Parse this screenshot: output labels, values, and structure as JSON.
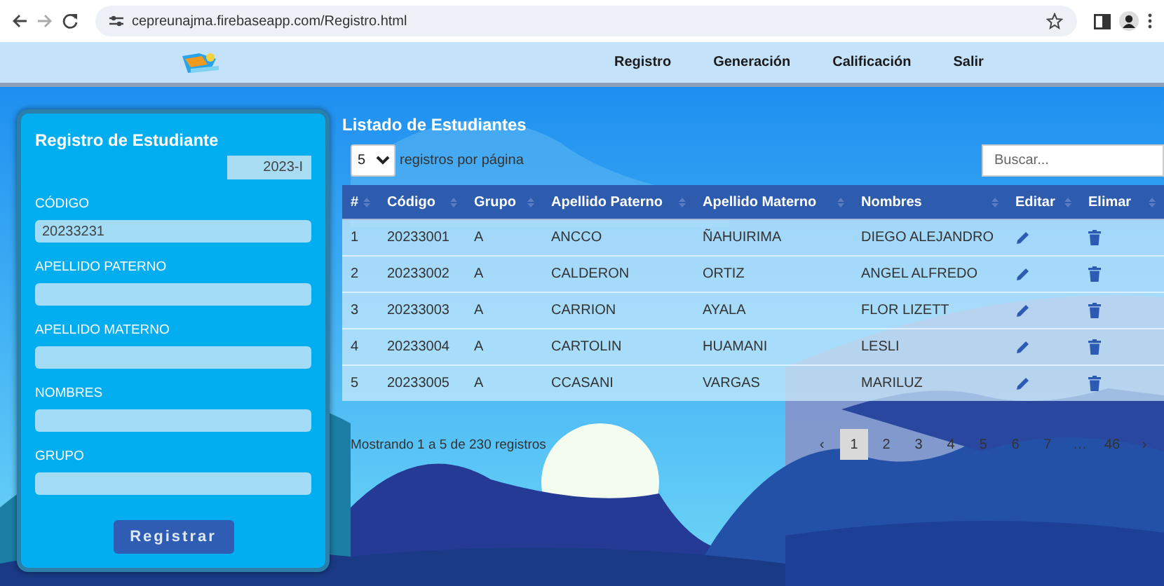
{
  "browser": {
    "url": "cepreunajma.firebaseapp.com/Registro.html"
  },
  "nav": {
    "items": [
      {
        "label": "Registro"
      },
      {
        "label": "Generación"
      },
      {
        "label": "Calificación"
      },
      {
        "label": "Salir"
      }
    ]
  },
  "form": {
    "title": "Registro de Estudiante",
    "period": "2023-I",
    "submit": "Registrar",
    "fields": [
      {
        "label": "CÓDIGO",
        "value": "20233231"
      },
      {
        "label": "APELLIDO PATERNO"
      },
      {
        "label": "APELLIDO MATERNO"
      },
      {
        "label": "NOMBRES"
      },
      {
        "label": "GRUPO"
      }
    ]
  },
  "list": {
    "title": "Listado de Estudiantes",
    "page_size": "5",
    "page_size_label": "registros por página",
    "search": {
      "placeholder": "Buscar..."
    },
    "columns": [
      "#",
      "Código",
      "Grupo",
      "Apellido Paterno",
      "Apellido Materno",
      "Nombres",
      "Editar",
      "Elimar"
    ],
    "rows": [
      [
        "1",
        "20233001",
        "A",
        "ANCCO",
        "ÑAHUIRIMA",
        "DIEGO ALEJANDRO"
      ],
      [
        "2",
        "20233002",
        "A",
        "CALDERON",
        "ORTIZ",
        "ANGEL ALFREDO"
      ],
      [
        "3",
        "20233003",
        "A",
        "CARRION",
        "AYALA",
        "FLOR LIZETT"
      ],
      [
        "4",
        "20233004",
        "A",
        "CARTOLIN",
        "HUAMANI",
        "LESLI"
      ],
      [
        "5",
        "20233005",
        "A",
        "CCASANI",
        "VARGAS",
        "MARILUZ"
      ]
    ],
    "summary": "Mostrando 1 a 5 de 230 registros",
    "pages": [
      {
        "label": "‹",
        "selected": false
      },
      {
        "label": "1",
        "selected": true
      },
      {
        "label": "2",
        "selected": false
      },
      {
        "label": "3",
        "selected": false
      },
      {
        "label": "4",
        "selected": false
      },
      {
        "label": "5",
        "selected": false
      },
      {
        "label": "6",
        "selected": false
      },
      {
        "label": "7",
        "selected": false
      },
      {
        "label": "…",
        "selected": false
      },
      {
        "label": "46",
        "selected": false
      },
      {
        "label": "›",
        "selected": false
      }
    ]
  }
}
